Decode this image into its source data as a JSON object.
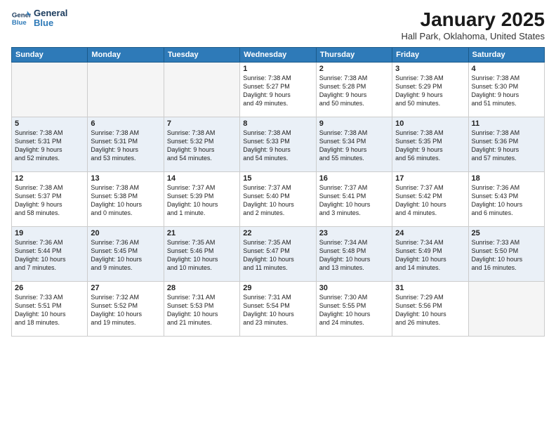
{
  "header": {
    "logo_line1": "General",
    "logo_line2": "Blue",
    "month_title": "January 2025",
    "location": "Hall Park, Oklahoma, United States"
  },
  "weekdays": [
    "Sunday",
    "Monday",
    "Tuesday",
    "Wednesday",
    "Thursday",
    "Friday",
    "Saturday"
  ],
  "weeks": [
    [
      {
        "day": "",
        "info": ""
      },
      {
        "day": "",
        "info": ""
      },
      {
        "day": "",
        "info": ""
      },
      {
        "day": "1",
        "info": "Sunrise: 7:38 AM\nSunset: 5:27 PM\nDaylight: 9 hours\nand 49 minutes."
      },
      {
        "day": "2",
        "info": "Sunrise: 7:38 AM\nSunset: 5:28 PM\nDaylight: 9 hours\nand 50 minutes."
      },
      {
        "day": "3",
        "info": "Sunrise: 7:38 AM\nSunset: 5:29 PM\nDaylight: 9 hours\nand 50 minutes."
      },
      {
        "day": "4",
        "info": "Sunrise: 7:38 AM\nSunset: 5:30 PM\nDaylight: 9 hours\nand 51 minutes."
      }
    ],
    [
      {
        "day": "5",
        "info": "Sunrise: 7:38 AM\nSunset: 5:31 PM\nDaylight: 9 hours\nand 52 minutes."
      },
      {
        "day": "6",
        "info": "Sunrise: 7:38 AM\nSunset: 5:31 PM\nDaylight: 9 hours\nand 53 minutes."
      },
      {
        "day": "7",
        "info": "Sunrise: 7:38 AM\nSunset: 5:32 PM\nDaylight: 9 hours\nand 54 minutes."
      },
      {
        "day": "8",
        "info": "Sunrise: 7:38 AM\nSunset: 5:33 PM\nDaylight: 9 hours\nand 54 minutes."
      },
      {
        "day": "9",
        "info": "Sunrise: 7:38 AM\nSunset: 5:34 PM\nDaylight: 9 hours\nand 55 minutes."
      },
      {
        "day": "10",
        "info": "Sunrise: 7:38 AM\nSunset: 5:35 PM\nDaylight: 9 hours\nand 56 minutes."
      },
      {
        "day": "11",
        "info": "Sunrise: 7:38 AM\nSunset: 5:36 PM\nDaylight: 9 hours\nand 57 minutes."
      }
    ],
    [
      {
        "day": "12",
        "info": "Sunrise: 7:38 AM\nSunset: 5:37 PM\nDaylight: 9 hours\nand 58 minutes."
      },
      {
        "day": "13",
        "info": "Sunrise: 7:38 AM\nSunset: 5:38 PM\nDaylight: 10 hours\nand 0 minutes."
      },
      {
        "day": "14",
        "info": "Sunrise: 7:37 AM\nSunset: 5:39 PM\nDaylight: 10 hours\nand 1 minute."
      },
      {
        "day": "15",
        "info": "Sunrise: 7:37 AM\nSunset: 5:40 PM\nDaylight: 10 hours\nand 2 minutes."
      },
      {
        "day": "16",
        "info": "Sunrise: 7:37 AM\nSunset: 5:41 PM\nDaylight: 10 hours\nand 3 minutes."
      },
      {
        "day": "17",
        "info": "Sunrise: 7:37 AM\nSunset: 5:42 PM\nDaylight: 10 hours\nand 4 minutes."
      },
      {
        "day": "18",
        "info": "Sunrise: 7:36 AM\nSunset: 5:43 PM\nDaylight: 10 hours\nand 6 minutes."
      }
    ],
    [
      {
        "day": "19",
        "info": "Sunrise: 7:36 AM\nSunset: 5:44 PM\nDaylight: 10 hours\nand 7 minutes."
      },
      {
        "day": "20",
        "info": "Sunrise: 7:36 AM\nSunset: 5:45 PM\nDaylight: 10 hours\nand 9 minutes."
      },
      {
        "day": "21",
        "info": "Sunrise: 7:35 AM\nSunset: 5:46 PM\nDaylight: 10 hours\nand 10 minutes."
      },
      {
        "day": "22",
        "info": "Sunrise: 7:35 AM\nSunset: 5:47 PM\nDaylight: 10 hours\nand 11 minutes."
      },
      {
        "day": "23",
        "info": "Sunrise: 7:34 AM\nSunset: 5:48 PM\nDaylight: 10 hours\nand 13 minutes."
      },
      {
        "day": "24",
        "info": "Sunrise: 7:34 AM\nSunset: 5:49 PM\nDaylight: 10 hours\nand 14 minutes."
      },
      {
        "day": "25",
        "info": "Sunrise: 7:33 AM\nSunset: 5:50 PM\nDaylight: 10 hours\nand 16 minutes."
      }
    ],
    [
      {
        "day": "26",
        "info": "Sunrise: 7:33 AM\nSunset: 5:51 PM\nDaylight: 10 hours\nand 18 minutes."
      },
      {
        "day": "27",
        "info": "Sunrise: 7:32 AM\nSunset: 5:52 PM\nDaylight: 10 hours\nand 19 minutes."
      },
      {
        "day": "28",
        "info": "Sunrise: 7:31 AM\nSunset: 5:53 PM\nDaylight: 10 hours\nand 21 minutes."
      },
      {
        "day": "29",
        "info": "Sunrise: 7:31 AM\nSunset: 5:54 PM\nDaylight: 10 hours\nand 23 minutes."
      },
      {
        "day": "30",
        "info": "Sunrise: 7:30 AM\nSunset: 5:55 PM\nDaylight: 10 hours\nand 24 minutes."
      },
      {
        "day": "31",
        "info": "Sunrise: 7:29 AM\nSunset: 5:56 PM\nDaylight: 10 hours\nand 26 minutes."
      },
      {
        "day": "",
        "info": ""
      }
    ]
  ]
}
